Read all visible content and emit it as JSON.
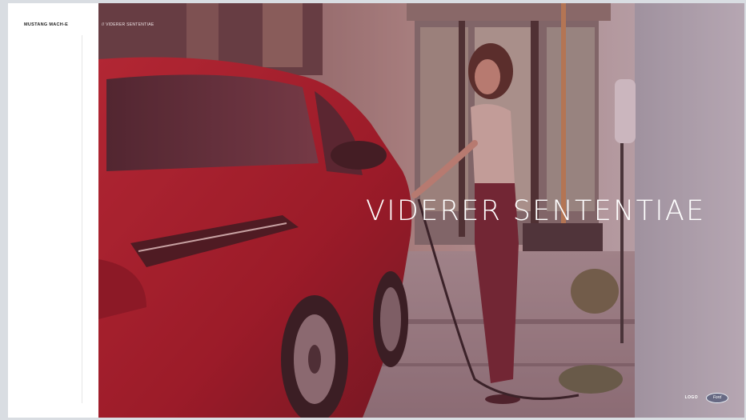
{
  "sidebar": {
    "brand": "MUSTANG MACH-E"
  },
  "hero": {
    "breadcrumb": "// VIDERER SENTENTIAE",
    "headline": "VIDERER SENTENTIAE",
    "image_icon": "photo-woman-charging-car"
  },
  "footer": {
    "logo_label": "LOGO",
    "ford_logo": "Ford"
  },
  "colors": {
    "overlay": "#8a3a4a",
    "car_red": "#b4141e"
  }
}
